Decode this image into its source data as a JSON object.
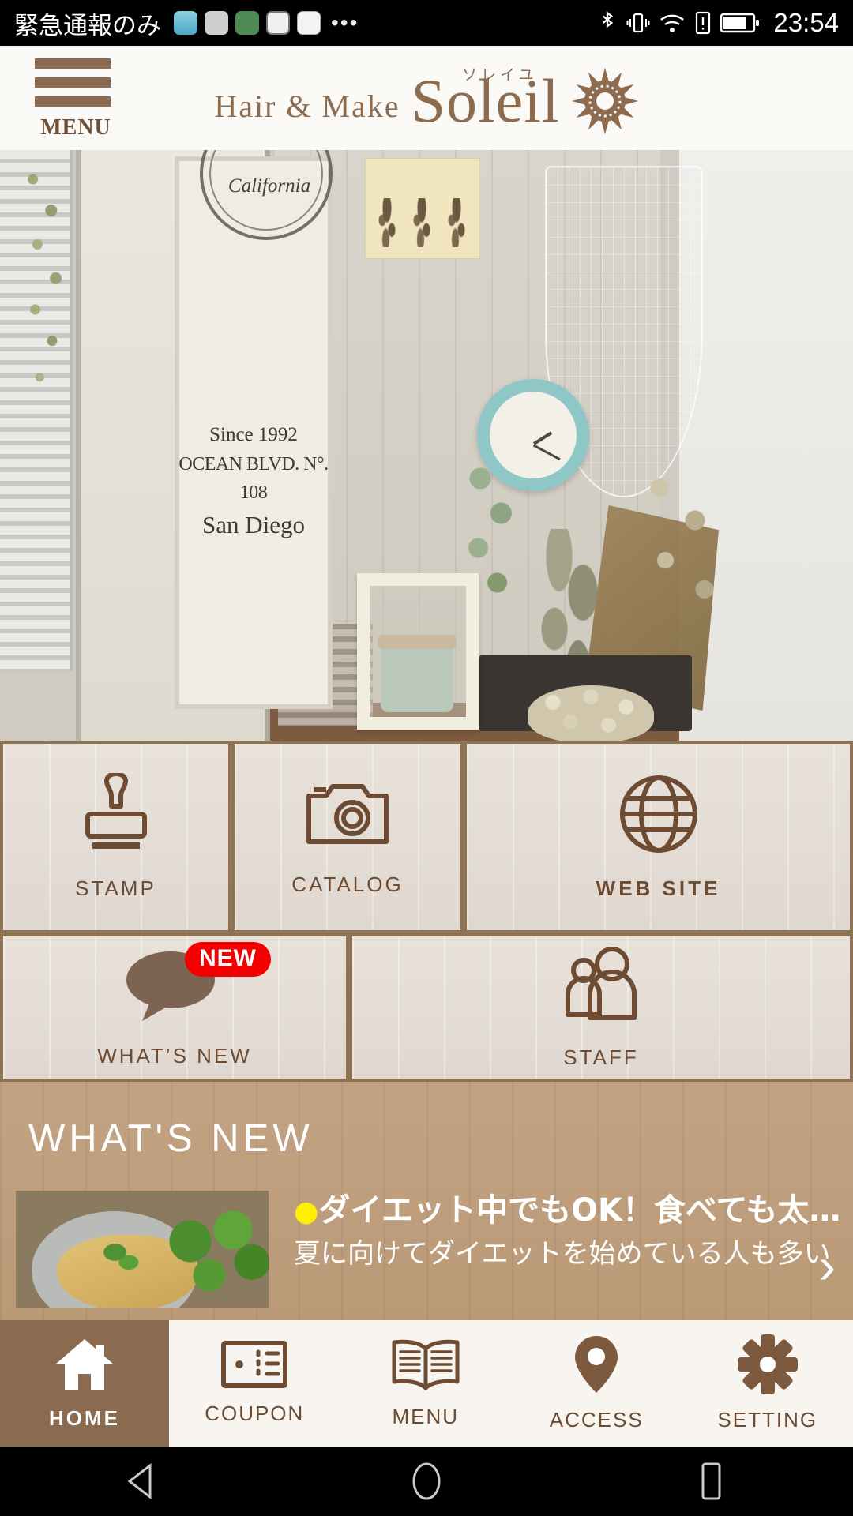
{
  "status_bar": {
    "carrier": "緊急通報のみ",
    "overflow_dots": "•••",
    "clock": "23:54",
    "icons": [
      "bluetooth-icon",
      "vibrate-icon",
      "wifi-icon",
      "sim-alert-icon",
      "battery-icon"
    ]
  },
  "header": {
    "menu_label": "MENU",
    "logo_prefix": "Hair & Make",
    "logo_name": "Soleil",
    "logo_ruby": "ソレイユ",
    "logo_mark": "sun-icon"
  },
  "hero": {
    "door_stamp": "California",
    "door_line1": "Since 1992",
    "door_line2": "OCEAN BLVD. N°. 108",
    "door_line3": "San Diego"
  },
  "grid": {
    "tiles": [
      {
        "id": "stamp",
        "label": "STAMP",
        "icon": "stamp-icon"
      },
      {
        "id": "catalog",
        "label": "CATALOG",
        "icon": "camera-icon"
      },
      {
        "id": "web",
        "label": "WEB SITE",
        "icon": "globe-icon"
      },
      {
        "id": "whats_new",
        "label": "WHAT’S NEW",
        "icon": "speech-bubble-icon",
        "badge": "NEW"
      },
      {
        "id": "staff",
        "label": "STAFF",
        "icon": "people-icon"
      }
    ]
  },
  "whats_new": {
    "section_title": "WHAT'S NEW",
    "item": {
      "bullet": "●",
      "headline": "ダイエット中でもOK！食べても太…",
      "summary": "夏に向けてダイエットを始めている人も多い",
      "chevron": "›",
      "thumbnail": "food-photo"
    }
  },
  "tab_bar": {
    "tabs": [
      {
        "id": "home",
        "label": "HOME",
        "icon": "house-icon",
        "active": true
      },
      {
        "id": "coupon",
        "label": "COUPON",
        "icon": "ticket-icon",
        "active": false
      },
      {
        "id": "menu",
        "label": "MENU",
        "icon": "book-icon",
        "active": false
      },
      {
        "id": "access",
        "label": "ACCESS",
        "icon": "map-pin-icon",
        "active": false
      },
      {
        "id": "setting",
        "label": "SETTING",
        "icon": "gear-icon",
        "active": false
      }
    ]
  },
  "nav_bar": {
    "back": "back-triangle-icon",
    "home": "home-circle-icon",
    "recents": "recents-square-icon"
  },
  "colors": {
    "brand_brown": "#8a6b4f",
    "icon_brown": "#6d4c33",
    "badge_red": "#f50000",
    "bullet_yellow": "#ffef00",
    "tile_bg": "#e5ded7"
  }
}
